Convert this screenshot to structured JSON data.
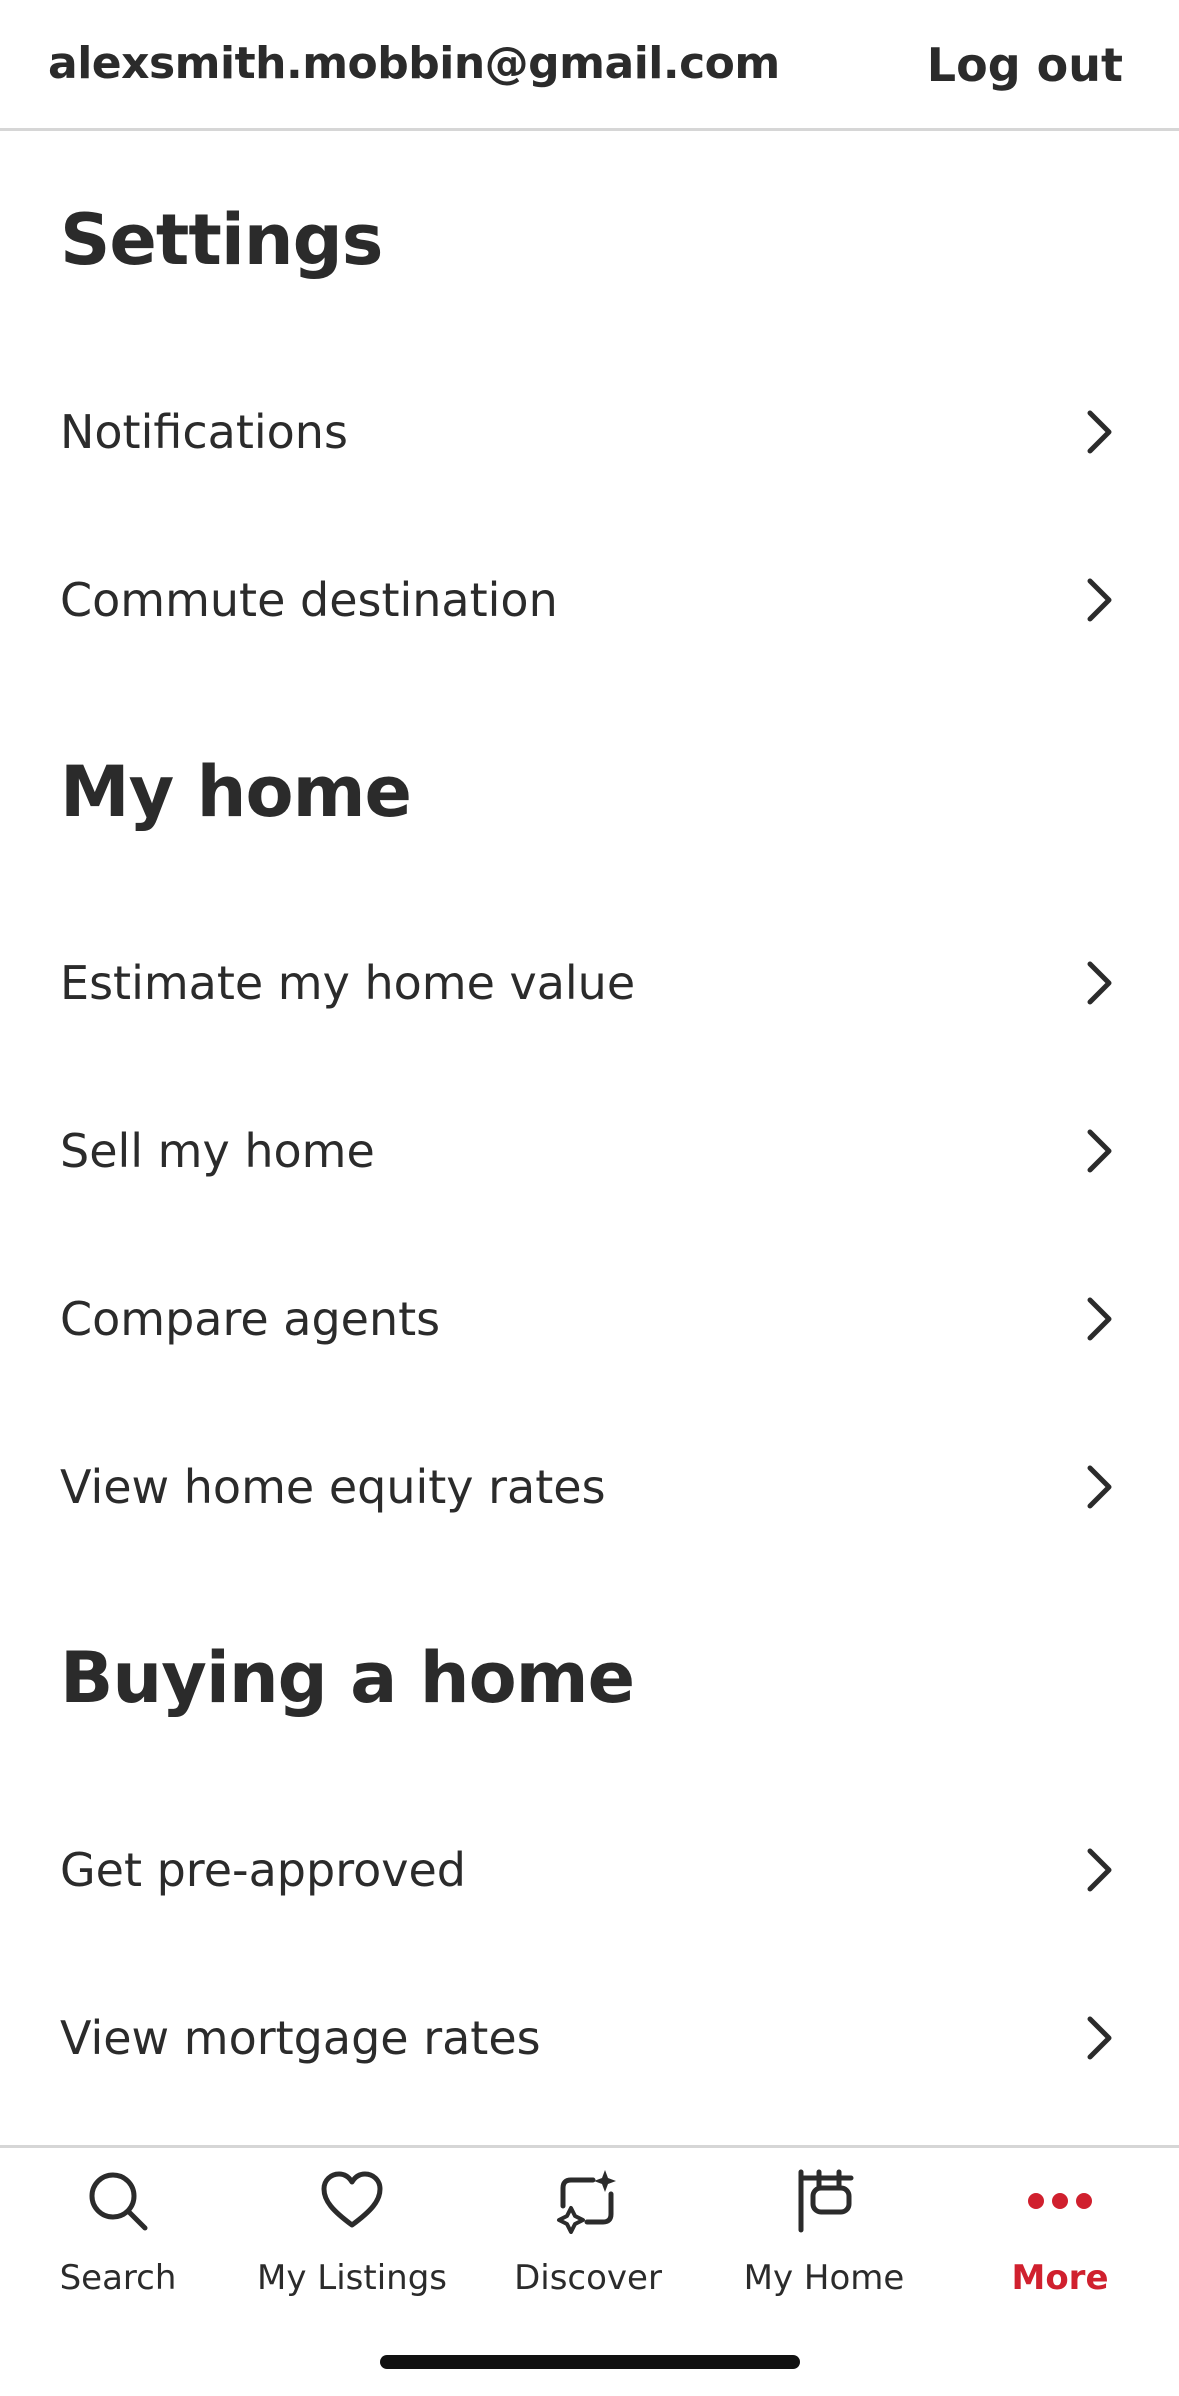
{
  "header": {
    "email": "alexsmith.mobbin@gmail.com",
    "logout_label": "Log out"
  },
  "sections": [
    {
      "title": "Settings",
      "items": [
        {
          "label": "Notifications"
        },
        {
          "label": "Commute destination"
        }
      ]
    },
    {
      "title": "My home",
      "items": [
        {
          "label": "Estimate my home value"
        },
        {
          "label": "Sell my home"
        },
        {
          "label": "Compare agents"
        },
        {
          "label": "View home equity rates"
        }
      ]
    },
    {
      "title": "Buying a home",
      "items": [
        {
          "label": "Get pre-approved"
        },
        {
          "label": "View mortgage rates"
        }
      ]
    }
  ],
  "tabbar": {
    "tabs": [
      {
        "label": "Search",
        "icon": "search-icon",
        "active": false
      },
      {
        "label": "My Listings",
        "icon": "heart-icon",
        "active": false
      },
      {
        "label": "Discover",
        "icon": "discover-icon",
        "active": false
      },
      {
        "label": "My Home",
        "icon": "home-sign-icon",
        "active": false
      },
      {
        "label": "More",
        "icon": "more-dots-icon",
        "active": true
      }
    ]
  },
  "colors": {
    "text": "#2b2b2b",
    "accent": "#d0202e",
    "divider": "#d6d6d6",
    "background": "#ffffff"
  }
}
